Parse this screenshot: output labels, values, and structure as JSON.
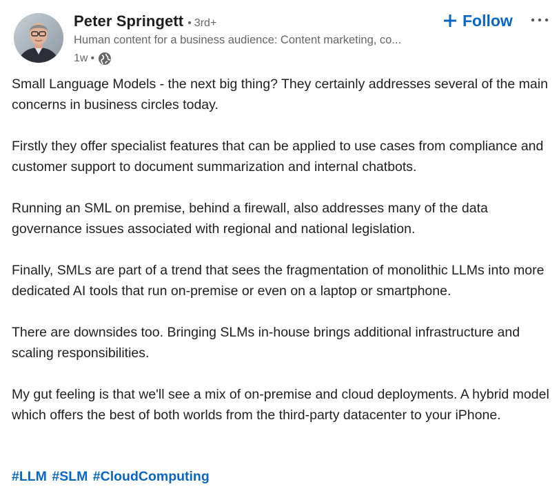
{
  "post": {
    "author": {
      "name": "Peter Springett",
      "connection_degree": "3rd+",
      "headline": "Human content for a business audience: Content marketing, co...",
      "timestamp": "1w",
      "visibility_icon": "globe-icon",
      "avatar_icon": "profile-photo"
    },
    "actions": {
      "follow_label": "Follow",
      "follow_icon": "plus-icon",
      "more_label": "···",
      "more_icon": "more-options-icon"
    },
    "body": {
      "paragraphs": [
        "Small Language Models - the next big thing? They certainly addresses several of the main concerns in business circles today.",
        "Firstly they offer specialist features that can be applied to use cases from compliance and customer support to document summarization and internal chatbots.",
        "Running an SML on premise, behind a firewall, also addresses many of the data governance issues associated with regional and national legislation.",
        "Finally, SMLs are part of a trend that sees the fragmentation of monolithic LLMs into more dedicated AI tools that run on-premise or even on a laptop or smartphone.",
        "There are downsides too. Bringing SLMs in-house brings additional infrastructure and scaling responsibilities.",
        "My gut feeling is that we'll see a mix of on-premise and cloud deployments. A hybrid model which offers the best of both worlds from the third-party datacenter to your iPhone."
      ],
      "hashtags": [
        "#LLM",
        "#SLM",
        "#CloudComputing"
      ]
    },
    "colors": {
      "accent": "#0a66c2",
      "text_primary": "#1f1f1f",
      "text_secondary": "#666666"
    }
  }
}
